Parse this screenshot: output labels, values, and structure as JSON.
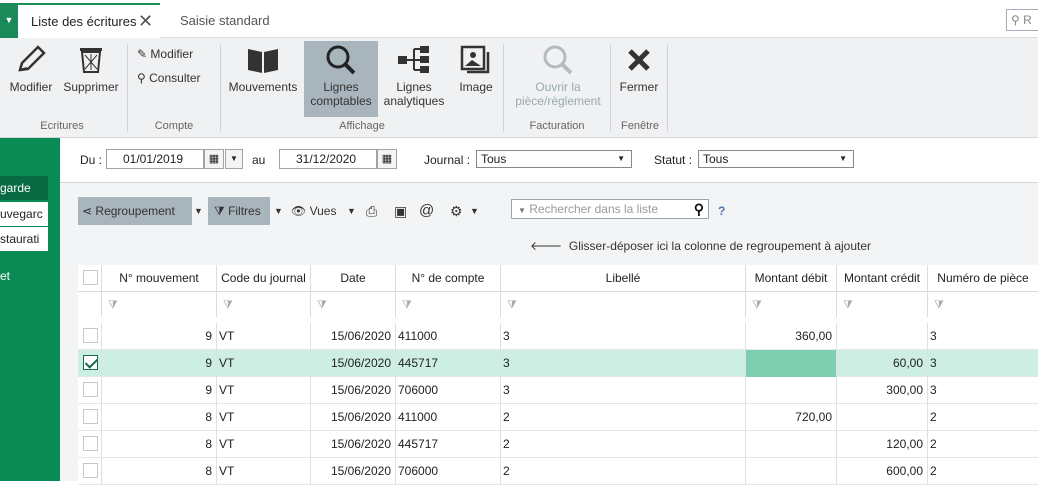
{
  "tabs": [
    {
      "label": "Liste des écritures",
      "active": true
    },
    {
      "label": "Saisie standard",
      "active": false
    }
  ],
  "top_search_placeholder": "R",
  "ribbon": {
    "groups": {
      "ecritures": "Ecritures",
      "compte": "Compte",
      "affichage": "Affichage",
      "facturation": "Facturation",
      "fenetre": "Fenêtre"
    },
    "buttons": {
      "modifier": "Modifier",
      "supprimer": "Supprimer",
      "compte_modifier": "Modifier",
      "compte_consulter": "Consulter",
      "mouvements": "Mouvements",
      "lignes_comptables_1": "Lignes",
      "lignes_comptables_2": "comptables",
      "lignes_analytiques_1": "Lignes",
      "lignes_analytiques_2": "analytiques",
      "image": "Image",
      "ouvrir_1": "Ouvrir la",
      "ouvrir_2": "pièce/règlement",
      "fermer": "Fermer"
    }
  },
  "sidebar": {
    "items": [
      "garde",
      "uvegarc",
      "staurati",
      "et"
    ]
  },
  "filters": {
    "du_label": "Du :",
    "du_value": "01/01/2019",
    "au_label": "au",
    "au_value": "31/12/2020",
    "journal_label": "Journal :",
    "journal_value": "Tous",
    "statut_label": "Statut :",
    "statut_value": "Tous"
  },
  "toolbar": {
    "regroupement": "Regroupement",
    "filtres": "Filtres",
    "vues": "Vues",
    "search_placeholder": "Rechercher dans la liste",
    "help": "?",
    "group_hint": "Glisser-déposer ici la colonne de regroupement à ajouter"
  },
  "table": {
    "columns": [
      "N° mouvement",
      "Code du journal",
      "Date",
      "N° de compte",
      "Libellé",
      "Montant débit",
      "Montant crédit",
      "Numéro de pièce"
    ],
    "rows": [
      {
        "checked": false,
        "mouvement": "9",
        "journal": "VT",
        "date": "15/06/2020",
        "compte": "411000",
        "libelle": "3",
        "debit": "360,00",
        "credit": "",
        "piece": "3"
      },
      {
        "checked": true,
        "mouvement": "9",
        "journal": "VT",
        "date": "15/06/2020",
        "compte": "445717",
        "libelle": "3",
        "debit": "",
        "credit": "60,00",
        "piece": "3"
      },
      {
        "checked": false,
        "mouvement": "9",
        "journal": "VT",
        "date": "15/06/2020",
        "compte": "706000",
        "libelle": "3",
        "debit": "",
        "credit": "300,00",
        "piece": "3"
      },
      {
        "checked": false,
        "mouvement": "8",
        "journal": "VT",
        "date": "15/06/2020",
        "compte": "411000",
        "libelle": "2",
        "debit": "720,00",
        "credit": "",
        "piece": "2"
      },
      {
        "checked": false,
        "mouvement": "8",
        "journal": "VT",
        "date": "15/06/2020",
        "compte": "445717",
        "libelle": "2",
        "debit": "",
        "credit": "120,00",
        "piece": "2"
      },
      {
        "checked": false,
        "mouvement": "8",
        "journal": "VT",
        "date": "15/06/2020",
        "compte": "706000",
        "libelle": "2",
        "debit": "",
        "credit": "600,00",
        "piece": "2"
      }
    ]
  },
  "colors": {
    "brand_green": "#0a8a55",
    "selected_row": "#cdeee2",
    "highlight_cell": "#7ecfb0"
  }
}
